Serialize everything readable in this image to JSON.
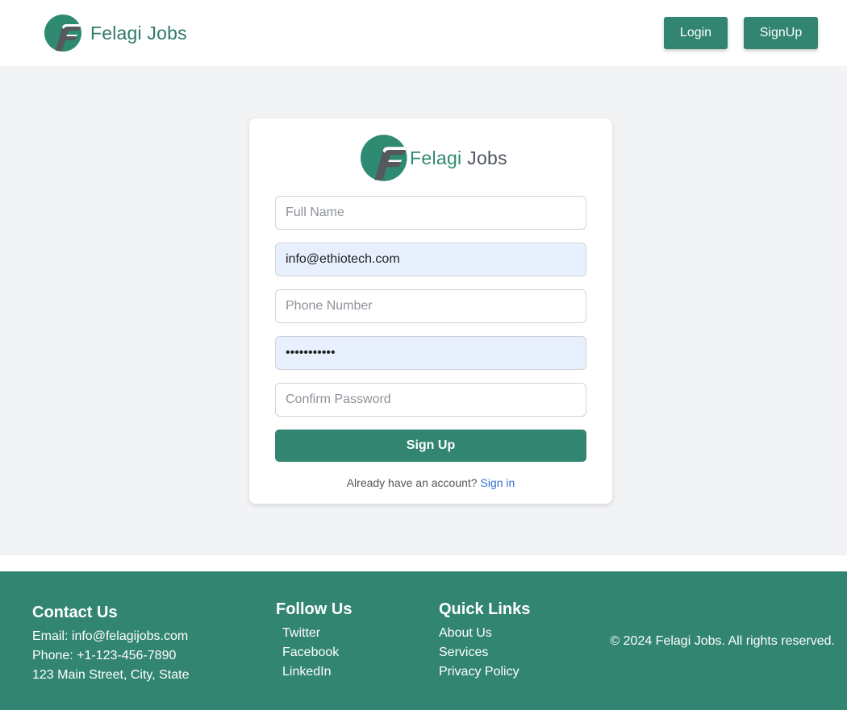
{
  "header": {
    "brand": "Felagi Jobs",
    "login_label": "Login",
    "signup_label": "SignUp"
  },
  "card": {
    "brand_first": "Felagi",
    "brand_second": " Jobs",
    "fields": {
      "full_name_placeholder": "Full Name",
      "email_value": "info@ethiotech.com",
      "phone_placeholder": "Phone Number",
      "password_value": "•••••••••••",
      "confirm_placeholder": "Confirm Password"
    },
    "submit_label": "Sign Up",
    "signin_prompt": "Already have an account?",
    "signin_link": "Sign in"
  },
  "footer": {
    "contact": {
      "title": "Contact Us",
      "email": "Email: info@felagijobs.com",
      "phone": "Phone: +1-123-456-7890",
      "address": "123 Main Street, City, State"
    },
    "follow": {
      "title": "Follow Us",
      "items": [
        "Twitter",
        "Facebook",
        "LinkedIn"
      ]
    },
    "links": {
      "title": "Quick Links",
      "items": [
        "About Us",
        "Services",
        "Privacy Policy"
      ]
    },
    "copyright": "© 2024 Felagi Jobs. All rights reserved."
  },
  "colors": {
    "primary": "#328571",
    "background": "#f2f3f5",
    "autofill": "#e8f0fe",
    "link": "#2f6fd6"
  }
}
